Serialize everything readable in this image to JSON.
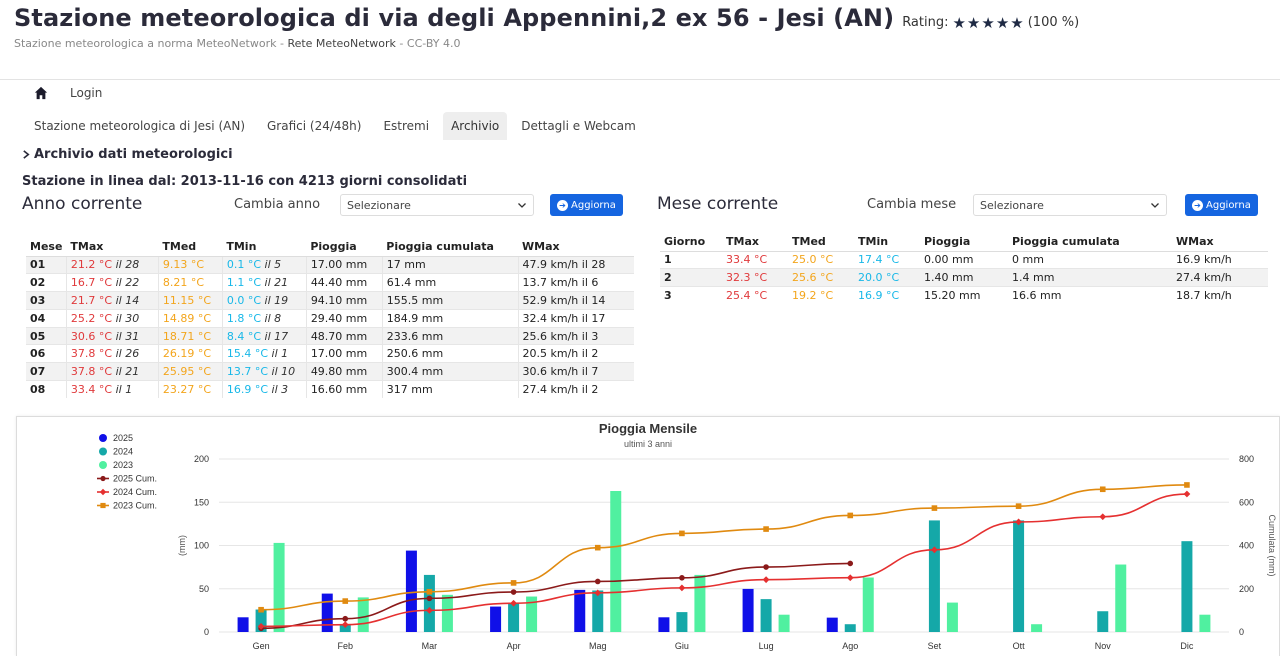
{
  "header": {
    "title": "Stazione meteorologica di via degli Appennini,2 ex 56 - Jesi (AN)",
    "rating_label": "Rating:",
    "rating_stars": 5,
    "rating_percent": "(100 %)",
    "subtitle_a": "Stazione meteorologica a norma MeteoNetwork - ",
    "subtitle_b": "Rete MeteoNetwork",
    "subtitle_c": " - CC-BY 4.0"
  },
  "nav": {
    "login": "Login"
  },
  "tabs": [
    {
      "label": "Stazione meteorologica di Jesi (AN)",
      "active": false
    },
    {
      "label": "Grafici (24/48h)",
      "active": false
    },
    {
      "label": "Estremi",
      "active": false
    },
    {
      "label": "Archivio",
      "active": true
    },
    {
      "label": "Dettagli e Webcam",
      "active": false
    }
  ],
  "section": {
    "archive_title": "Archivio dati meteorologici",
    "online_since": "Stazione in linea dal: 2013-11-16 con 4213 giorni consolidati"
  },
  "year_block": {
    "title": "Anno corrente",
    "change_label": "Cambia anno",
    "select_value": "Selezionare",
    "button_label": "Aggiorna",
    "columns": [
      "Mese",
      "TMax",
      "TMed",
      "TMin",
      "Pioggia",
      "Pioggia cumulata",
      "WMax"
    ],
    "rows": [
      {
        "m": "01",
        "tmax": "21.2 °C",
        "tmax_d": "il 28",
        "tmed": "9.13 °C",
        "tmin": "0.1 °C",
        "tmin_d": "il 5",
        "rain": "17.00 mm",
        "cum": "17 mm",
        "wmax": "47.9 km/h il 28"
      },
      {
        "m": "02",
        "tmax": "16.7 °C",
        "tmax_d": "il 22",
        "tmed": "8.21 °C",
        "tmin": "1.1 °C",
        "tmin_d": "il 21",
        "rain": "44.40 mm",
        "cum": "61.4 mm",
        "wmax": "13.7 km/h il 6"
      },
      {
        "m": "03",
        "tmax": "21.7 °C",
        "tmax_d": "il 14",
        "tmed": "11.15 °C",
        "tmin": "0.0 °C",
        "tmin_d": "il 19",
        "rain": "94.10 mm",
        "cum": "155.5 mm",
        "wmax": "52.9 km/h il 14"
      },
      {
        "m": "04",
        "tmax": "25.2 °C",
        "tmax_d": "il 30",
        "tmed": "14.89 °C",
        "tmin": "1.8 °C",
        "tmin_d": "il 8",
        "rain": "29.40 mm",
        "cum": "184.9 mm",
        "wmax": "32.4 km/h il 17"
      },
      {
        "m": "05",
        "tmax": "30.6 °C",
        "tmax_d": "il 31",
        "tmed": "18.71 °C",
        "tmin": "8.4 °C",
        "tmin_d": "il 17",
        "rain": "48.70 mm",
        "cum": "233.6 mm",
        "wmax": "25.6 km/h il 3"
      },
      {
        "m": "06",
        "tmax": "37.8 °C",
        "tmax_d": "il 26",
        "tmed": "26.19 °C",
        "tmin": "15.4 °C",
        "tmin_d": "il 1",
        "rain": "17.00 mm",
        "cum": "250.6 mm",
        "wmax": "20.5 km/h il 2"
      },
      {
        "m": "07",
        "tmax": "37.8 °C",
        "tmax_d": "il 21",
        "tmed": "25.95 °C",
        "tmin": "13.7 °C",
        "tmin_d": "il 10",
        "rain": "49.80 mm",
        "cum": "300.4 mm",
        "wmax": "30.6 km/h il 7"
      },
      {
        "m": "08",
        "tmax": "33.4 °C",
        "tmax_d": "il 1",
        "tmed": "23.27 °C",
        "tmin": "16.9 °C",
        "tmin_d": "il 3",
        "rain": "16.60 mm",
        "cum": "317 mm",
        "wmax": "27.4 km/h il 2"
      }
    ]
  },
  "month_block": {
    "title": "Mese corrente",
    "change_label": "Cambia mese",
    "select_value": "Selezionare",
    "button_label": "Aggiorna",
    "columns": [
      "Giorno",
      "TMax",
      "TMed",
      "TMin",
      "Pioggia",
      "Pioggia cumulata",
      "WMax"
    ],
    "rows": [
      {
        "d": "1",
        "tmax": "33.4 °C",
        "tmed": "25.0 °C",
        "tmin": "17.4 °C",
        "rain": "0.00 mm",
        "cum": "0 mm",
        "wmax": "16.9 km/h"
      },
      {
        "d": "2",
        "tmax": "32.3 °C",
        "tmed": "25.6 °C",
        "tmin": "20.0 °C",
        "rain": "1.40 mm",
        "cum": "1.4 mm",
        "wmax": "27.4 km/h"
      },
      {
        "d": "3",
        "tmax": "25.4 °C",
        "tmed": "19.2 °C",
        "tmin": "16.9 °C",
        "rain": "15.20 mm",
        "cum": "16.6 mm",
        "wmax": "18.7 km/h"
      }
    ]
  },
  "colors": {
    "accent": "#1565e0",
    "tmax": "#e0393b",
    "tmed": "#f3a51c",
    "tmin": "#18b8e8"
  },
  "chart_data": {
    "type": "bar",
    "title": "Pioggia Mensile",
    "subtitle": "ultimi 3 anni",
    "ylabel": "(mm)",
    "y2label": "Cumulata (mm)",
    "ylim": [
      0,
      200
    ],
    "y2lim": [
      0,
      800
    ],
    "yticks": [
      0,
      50,
      100,
      150,
      200
    ],
    "y2ticks": [
      0,
      200,
      400,
      600,
      800
    ],
    "categories": [
      "Gen",
      "Feb",
      "Mar",
      "Apr",
      "Mag",
      "Giu",
      "Lug",
      "Ago",
      "Set",
      "Ott",
      "Nov",
      "Dic"
    ],
    "legend_position": "top-left",
    "series": [
      {
        "name": "2025",
        "kind": "bar",
        "color": "#1010e8",
        "values": [
          17,
          44.4,
          94.1,
          29.4,
          48.7,
          17,
          49.8,
          16.6,
          null,
          null,
          null,
          null
        ]
      },
      {
        "name": "2024",
        "kind": "bar",
        "color": "#15a8a8",
        "values": [
          26,
          8,
          66,
          33,
          48,
          23,
          38,
          9,
          129,
          129,
          24,
          105
        ]
      },
      {
        "name": "2023",
        "kind": "bar",
        "color": "#50f0a0",
        "values": [
          103,
          40,
          43,
          41,
          163,
          66,
          20,
          63,
          34,
          9,
          78,
          20
        ]
      },
      {
        "name": "2025 Cum.",
        "kind": "line",
        "axis": "right",
        "color": "#8b1a1a",
        "marker": "circle",
        "values": [
          17,
          61.4,
          155.5,
          184.9,
          233.6,
          250.6,
          300.4,
          317,
          null,
          null,
          null,
          null
        ]
      },
      {
        "name": "2024 Cum.",
        "kind": "line",
        "axis": "right",
        "color": "#e53030",
        "marker": "diamond",
        "values": [
          26,
          34,
          100,
          133,
          181,
          204,
          242,
          251,
          380,
          509,
          533,
          638
        ]
      },
      {
        "name": "2023 Cum.",
        "kind": "line",
        "axis": "right",
        "color": "#e08a10",
        "marker": "square",
        "values": [
          103,
          143,
          186,
          227,
          390,
          456,
          476,
          539,
          573,
          582,
          660,
          680
        ]
      }
    ]
  }
}
